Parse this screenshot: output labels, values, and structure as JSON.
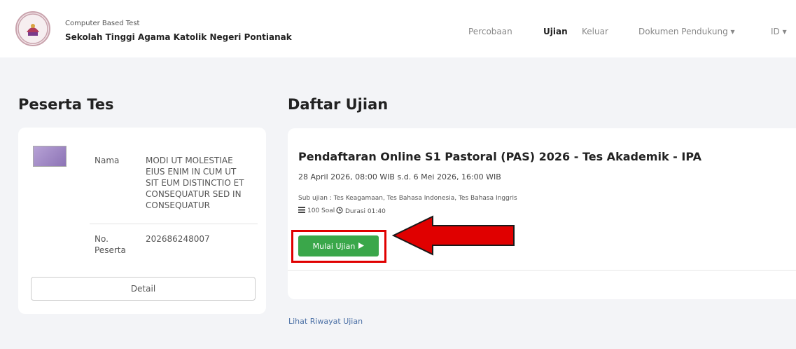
{
  "header": {
    "subtitle": "Computer Based Test",
    "title": "Sekolah Tinggi Agama Katolik Negeri Pontianak",
    "nav": [
      {
        "label": "Percobaan"
      },
      {
        "label": "Ujian"
      },
      {
        "label": "Keluar"
      },
      {
        "label": "Dokumen Pendukung ▾"
      },
      {
        "label": "ID ▾"
      }
    ]
  },
  "left": {
    "heading": "Peserta Tes",
    "name_label": "Nama",
    "name_lines": [
      "MODI UT MOLESTIAE",
      "EIUS ENIM IN CUM UT",
      "SIT EUM DISTINCTIO ET",
      "CONSEQUATUR SED IN",
      "CONSEQUATUR"
    ],
    "no_label_1": "No.",
    "no_label_2": "Peserta",
    "no_value": "202686248007",
    "detail_button": "Detail"
  },
  "right": {
    "heading": "Daftar Ujian",
    "exam_title": "Pendaftaran Online S1 Pastoral (PAS) 2026 - Tes Akademik - IPA",
    "exam_date": "28 April 2026, 08:00 WIB s.d. 6 Mei 2026, 16:00 WIB",
    "sub_exams": "Sub ujian : Tes Keagamaan, Tes Bahasa Indonesia, Tes Bahasa Inggris",
    "questions": "100 Soal",
    "duration": "Durasi 01:40",
    "start_button": "Mulai Ujian",
    "history_link": "Lihat Riwayat Ujian"
  },
  "colors": {
    "accent_green": "#3aa74a",
    "highlight_red": "#e00000",
    "link_blue": "#4a6fa5"
  }
}
